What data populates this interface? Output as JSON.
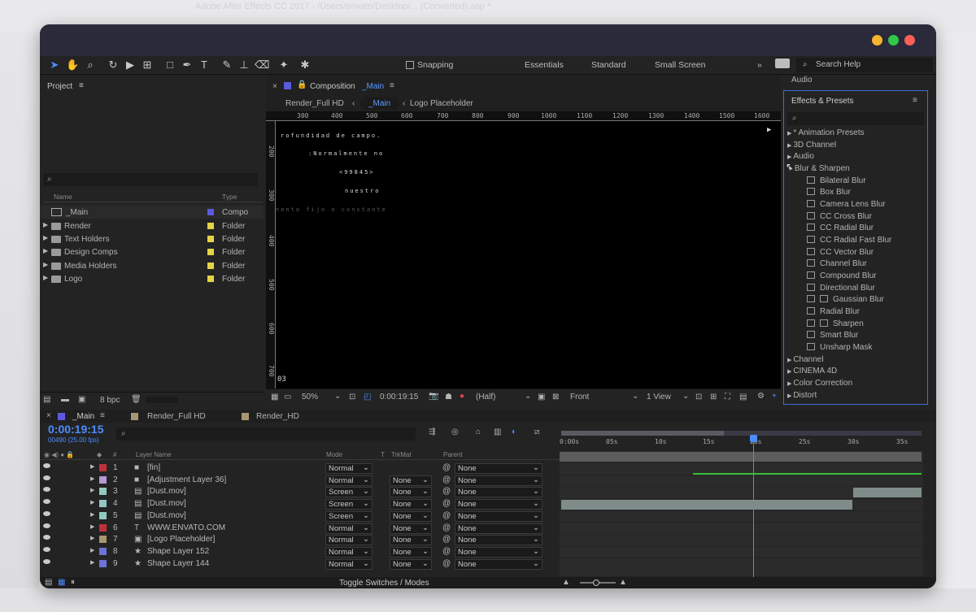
{
  "window_title": "Adobe After Effects CC 2017 - /Users/envato/Desktop/... (Converted).aep *",
  "toolbar": {
    "snapping": "Snapping",
    "workspaces": [
      "Essentials",
      "Standard",
      "Small Screen"
    ],
    "search_help": "Search Help"
  },
  "project": {
    "title": "Project",
    "search_placeholder": "",
    "col_name": "Name",
    "col_type": "Type",
    "items": [
      {
        "name": "_Main",
        "type": "Compo",
        "color": "#5a5adc",
        "icon": "composition-icon"
      },
      {
        "name": "Render",
        "type": "Folder",
        "color": "#e3d447",
        "icon": "folder-icon"
      },
      {
        "name": "Text Holders",
        "type": "Folder",
        "color": "#e3d447",
        "icon": "folder-icon"
      },
      {
        "name": "Design Comps",
        "type": "Folder",
        "color": "#e3d447",
        "icon": "folder-icon"
      },
      {
        "name": "Media Holders",
        "type": "Folder",
        "color": "#e3d447",
        "icon": "folder-icon"
      },
      {
        "name": "Logo",
        "type": "Folder",
        "color": "#e3d447",
        "icon": "folder-icon"
      }
    ],
    "bpc": "8 bpc"
  },
  "composition": {
    "tab_label": "Composition",
    "tab_name": "_Main",
    "breadcrumbs": [
      "Render_Full HD",
      "_Main",
      "Logo Placeholder"
    ],
    "ruler_ticks": [
      "300",
      "400",
      "500",
      "600",
      "700",
      "800",
      "900",
      "1000",
      "1100",
      "1200",
      "1300",
      "1400",
      "1500",
      "1600"
    ],
    "vruler_ticks": [
      "200",
      "300",
      "400",
      "500",
      "600",
      "700"
    ],
    "viewer_texts": [
      "rofundidad de campo.",
      ":Normalmente no",
      "<99845>",
      "nuestro",
      "nento fijo o constante",
      "03"
    ],
    "zoom": "50%",
    "timecode": "0:00:19:15",
    "resolution": "(Half)",
    "view": "Front",
    "view_count": "1 View"
  },
  "right_panel": {
    "audio": "Audio",
    "effects_title": "Effects & Presets",
    "search_placeholder": "",
    "categories_top": [
      "* Animation Presets",
      "3D Channel",
      "Audio",
      "Blur & Sharpen"
    ],
    "blur_items": [
      "Bilateral Blur",
      "Box Blur",
      "Camera Lens Blur",
      "CC Cross Blur",
      "CC Radial Blur",
      "CC Radial Fast Blur",
      "CC Vector Blur",
      "Channel Blur",
      "Compound Blur",
      "Directional Blur",
      "Gaussian Blur",
      "Radial Blur",
      "Sharpen",
      "Smart Blur",
      "Unsharp Mask"
    ],
    "categories_bottom": [
      "Channel",
      "CINEMA 4D",
      "Color Correction",
      "Distort"
    ]
  },
  "timeline": {
    "tabs": [
      "_Main",
      "Render_Full HD",
      "Render_HD"
    ],
    "timecode": "0:00:19:15",
    "frame_info": "00490 (25.00 fps)",
    "columns": {
      "num": "#",
      "layer": "Layer Name",
      "mode": "Mode",
      "t": "T",
      "trkmat": "TrkMat",
      "parent": "Parent"
    },
    "ruler": [
      "0:00s",
      "05s",
      "10s",
      "15s",
      "20s",
      "25s",
      "30s",
      "35s"
    ],
    "layers": [
      {
        "num": "1",
        "name": "[fin]",
        "color": "#c0303a",
        "mode": "Normal",
        "trkmat": "",
        "parent": "None",
        "icon": "solid-icon"
      },
      {
        "num": "2",
        "name": "[Adjustment Layer 36]",
        "color": "#b39ad6",
        "mode": "Normal",
        "trkmat": "None",
        "parent": "None",
        "icon": "solid-icon"
      },
      {
        "num": "3",
        "name": "[Dust.mov]",
        "color": "#8fc9c0",
        "mode": "Screen",
        "trkmat": "None",
        "parent": "None",
        "icon": "footage-icon"
      },
      {
        "num": "4",
        "name": "[Dust.mov]",
        "color": "#8fc9c0",
        "mode": "Screen",
        "trkmat": "None",
        "parent": "None",
        "icon": "footage-icon"
      },
      {
        "num": "5",
        "name": "[Dust.mov]",
        "color": "#8fc9c0",
        "mode": "Screen",
        "trkmat": "None",
        "parent": "None",
        "icon": "footage-icon"
      },
      {
        "num": "6",
        "name": "WWW.ENVATO.COM",
        "color": "#c0303a",
        "mode": "Normal",
        "trkmat": "None",
        "parent": "None",
        "icon": "text-icon"
      },
      {
        "num": "7",
        "name": "[Logo Placeholder]",
        "color": "#a79670",
        "mode": "Normal",
        "trkmat": "None",
        "parent": "None",
        "icon": "precomp-icon"
      },
      {
        "num": "8",
        "name": "Shape Layer 152",
        "color": "#6b74d8",
        "mode": "Normal",
        "trkmat": "None",
        "parent": "None",
        "icon": "star-icon"
      },
      {
        "num": "9",
        "name": "Shape Layer 144",
        "color": "#6b74d8",
        "mode": "Normal",
        "trkmat": "None",
        "parent": "None",
        "icon": "star-icon"
      }
    ],
    "toggle": "Toggle Switches / Modes"
  }
}
